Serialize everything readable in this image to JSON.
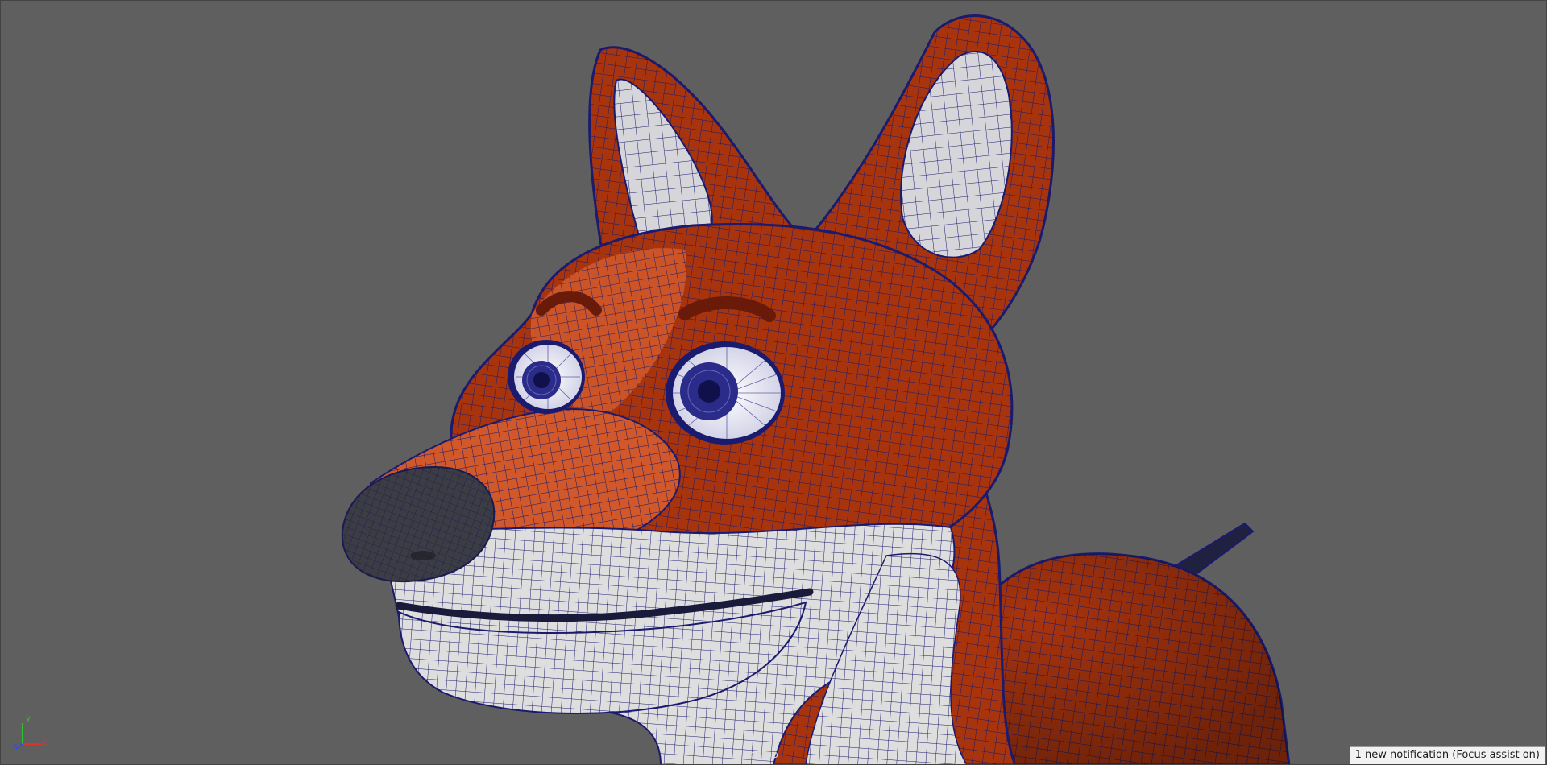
{
  "viewport": {
    "camera": "persp",
    "background_color": "#5f5f5f"
  },
  "model": {
    "subject": "fox-character-head",
    "fur_color": "#9a2e0c",
    "fur_highlight": "#e0703f",
    "belly_color": "#dcdcdc",
    "nose_color": "#3a3a3a",
    "wire_color": "#1a1a6e",
    "iris_color": "#2b2b8a"
  },
  "axis_gizmo": {
    "x_label": "x",
    "y_label": "y",
    "z_label": "z",
    "x_color": "#e03030",
    "y_color": "#30c030",
    "z_color": "#3050e0"
  },
  "notification": {
    "text": "1 new notification (Focus assist on)"
  }
}
